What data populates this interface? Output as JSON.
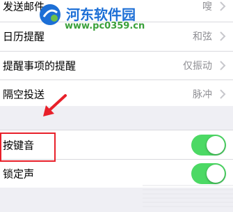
{
  "rows_top": [
    {
      "label": "发送邮件",
      "value": "嗖"
    },
    {
      "label": "日历提醒",
      "value": "和弦"
    },
    {
      "label": "提醒事项的提醒",
      "value": "仅振动"
    },
    {
      "label": "隔空投送",
      "value": "脉冲"
    }
  ],
  "rows_bottom": [
    {
      "label": "按键音",
      "on": true
    },
    {
      "label": "锁定声",
      "on": true
    }
  ],
  "watermark": {
    "title": "河东软件园",
    "url": "www.pc0359.cn"
  },
  "colors": {
    "toggle_on": "#4cd964",
    "highlight": "#e8202a",
    "watermark_blue": "#1d6fd6",
    "watermark_green": "#3aa03a"
  }
}
